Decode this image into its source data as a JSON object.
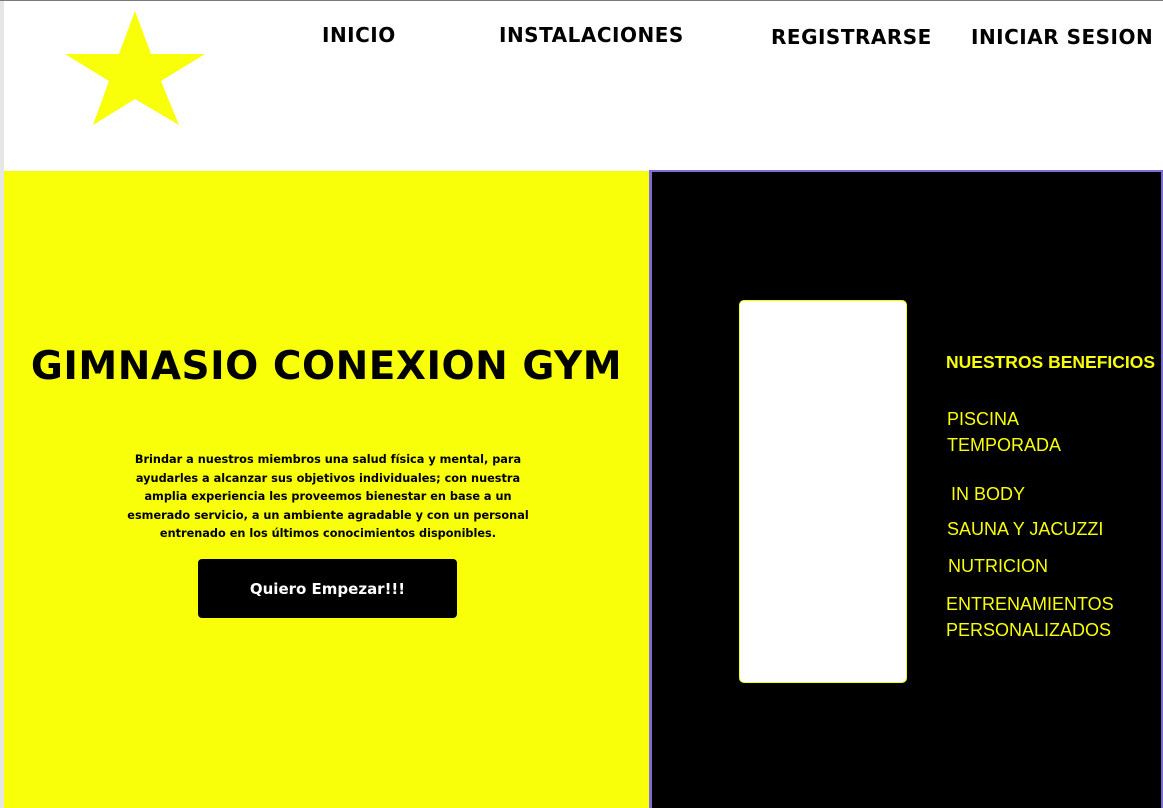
{
  "nav": {
    "items": [
      {
        "label": "INICIO"
      },
      {
        "label": "INSTALACIONES"
      },
      {
        "label": "REGISTRARSE"
      },
      {
        "label": "INICIAR SESION"
      }
    ]
  },
  "hero": {
    "title": "GIMNASIO CONEXION GYM",
    "description": "Brindar a nuestros miembros una salud física y mental, para ayudarles a alcanzar sus objetivos individuales; con nuestra amplia experiencia les proveemos bienestar en base a un esmerado servicio, a un ambiente agradable y con un personal entrenado en los últimos conocimientos disponibles.",
    "cta_label": "Quiero Empezar!!!"
  },
  "benefits": {
    "heading": "NUESTROS BENEFICIOS",
    "items": [
      {
        "line1": "PISCINA",
        "line2": "TEMPORADA"
      },
      {
        "line1": "IN BODY"
      },
      {
        "line1": "SAUNA Y JACUZZI"
      },
      {
        "line1": "NUTRICION"
      },
      {
        "line1": "ENTRENAMIENTOS",
        "line2": "PERSONALIZADOS"
      }
    ]
  },
  "colors": {
    "accent_yellow": "#f8ff08",
    "dark": "#000000",
    "panel_border": "#7b6cd9"
  },
  "icons": {
    "logo": "star-icon"
  }
}
